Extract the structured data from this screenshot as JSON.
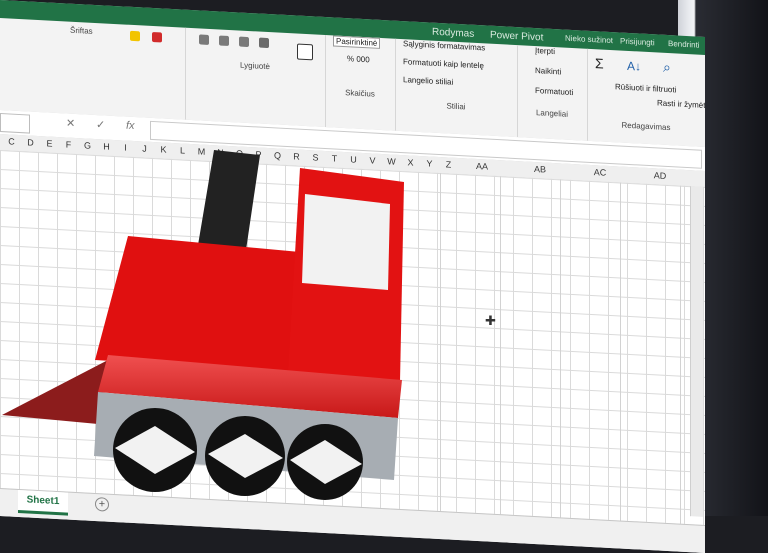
{
  "titlebar": {
    "search": "Nieko sužinot",
    "signin": "Prisijungti",
    "share": "Bendrinti",
    "tab_view": "Rodymas",
    "tab_powerpivot": "Power Pivot"
  },
  "ribbon": {
    "font_group": "Šriftas",
    "alignment_group": "Lygiuotė",
    "number_group": "Skaičius",
    "number_format": "Pasirinktinė",
    "percent": "% 000",
    "styles_group": "Stiliai",
    "conditional_formatting": "Sąlyginis formatavimas",
    "format_as_table": "Formatuoti kaip lentelę",
    "cell_styles": "Langelio stiliai",
    "cells_group": "Langeliai",
    "insert": "Įterpti",
    "delete": "Naikinti",
    "format": "Formatuoti",
    "editing_group": "Redagavimas",
    "sort_filter": "Rūšiuoti ir filtruoti",
    "find_select": "Rasti ir žymėti"
  },
  "formula": {
    "cancel": "✕",
    "enter": "✓",
    "fx": "fx"
  },
  "columns": [
    "C",
    "D",
    "E",
    "F",
    "G",
    "H",
    "I",
    "J",
    "K",
    "L",
    "M",
    "N",
    "O",
    "P",
    "Q",
    "R",
    "S",
    "T",
    "U",
    "V",
    "W",
    "X",
    "Y",
    "Z"
  ],
  "wide_columns": [
    "AA",
    "AB",
    "AC",
    "AD"
  ],
  "sheet": {
    "tab": "Sheet1",
    "add": "+"
  },
  "colors": {
    "excel_green": "#217346",
    "train_red": "#e01010",
    "train_dark_red": "#8c1c1c",
    "chimney": "#222222",
    "base_gray": "#a7adb3",
    "wheel_black": "#111111"
  },
  "icons": [
    "fill-color-icon",
    "font-color-icon",
    "align-icon",
    "merge-icon",
    "borders-icon",
    "autosum-icon",
    "sort-filter-icon",
    "find-icon",
    "cursor-cross-icon"
  ]
}
